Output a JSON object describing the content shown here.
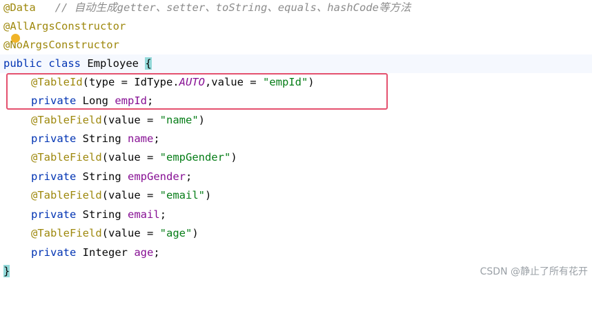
{
  "lines": [
    {
      "ann": "@Data",
      "comment": "// 自动生成getter、setter、toString、equals、hashCode等方法"
    },
    {
      "ann": "@AllArgsConstructor"
    },
    {
      "ann": "@NoArgsConstructor"
    },
    {
      "kw": "public class",
      "name": "Employee",
      "brace": "{"
    },
    {
      "ann": "@TableId",
      "p1": "(type = IdType.",
      "const": "AUTO",
      "p2": ",value = ",
      "str": "\"empId\"",
      "p3": ")"
    },
    {
      "kw": "private",
      "type": "Long",
      "field": "empId",
      "semi": ";"
    },
    {
      "ann": "@TableField",
      "p1": "(value = ",
      "str": "\"name\"",
      "p3": ")"
    },
    {
      "kw": "private",
      "type": "String",
      "field": "name",
      "semi": ";"
    },
    {
      "ann": "@TableField",
      "p1": "(value = ",
      "str": "\"empGender\"",
      "p3": ")"
    },
    {
      "kw": "private",
      "type": "String",
      "field": "empGender",
      "semi": ";"
    },
    {
      "ann": "@TableField",
      "p1": "(value = ",
      "str": "\"email\"",
      "p3": ")"
    },
    {
      "kw": "private",
      "type": "String",
      "field": "email",
      "semi": ";"
    },
    {
      "ann": "@TableField",
      "p1": "(value = ",
      "str": "\"age\"",
      "p3": ")"
    },
    {
      "kw": "private",
      "type": "Integer",
      "field": "age",
      "semi": ";"
    },
    {
      "brace": "}"
    }
  ],
  "watermark": "CSDN @静止了所有花开",
  "colors": {
    "annotation": "#9e880d",
    "keyword": "#0033b3",
    "field": "#871094",
    "string": "#067d17",
    "comment": "#8c8c8c",
    "highlight_box": "#e4506e",
    "brace_match": "#93d9d9"
  },
  "icons": {
    "gutter": "intention-bulb-icon"
  }
}
